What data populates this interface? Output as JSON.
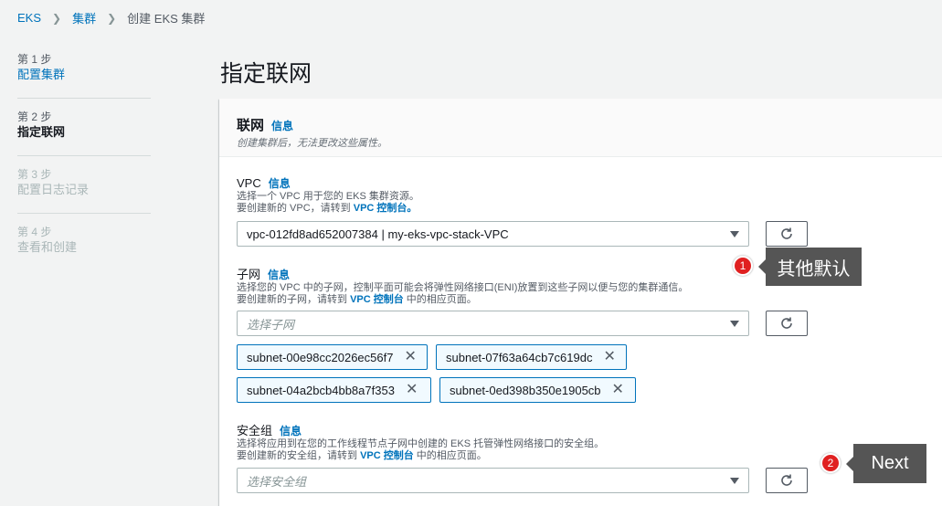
{
  "breadcrumb": {
    "root": "EKS",
    "clusters": "集群",
    "current": "创建 EKS 集群"
  },
  "steps": [
    {
      "num": "第 1 步",
      "name": "配置集群"
    },
    {
      "num": "第 2 步",
      "name": "指定联网"
    },
    {
      "num": "第 3 步",
      "name": "配置日志记录"
    },
    {
      "num": "第 4 步",
      "name": "查看和创建"
    }
  ],
  "page_title": "指定联网",
  "panel": {
    "title": "联网",
    "info": "信息",
    "desc": "创建集群后，无法更改这些属性。"
  },
  "vpc": {
    "label": "VPC",
    "info": "信息",
    "desc1": "选择一个 VPC 用于您的 EKS 集群资源。",
    "desc2_prefix": "要创建新的 VPC，请转到 ",
    "desc2_link": "VPC 控制台。",
    "value": "vpc-012fd8ad652007384 | my-eks-vpc-stack-VPC"
  },
  "subnets": {
    "label": "子网",
    "info": "信息",
    "desc1": "选择您的 VPC 中的子网，控制平面可能会将弹性网络接口(ENI)放置到这些子网以便与您的集群通信。",
    "desc2_prefix": "要创建新的子网，请转到 ",
    "desc2_link": "VPC 控制台",
    "desc2_suffix": " 中的相应页面。",
    "placeholder": "选择子网",
    "tokens": [
      "subnet-00e98cc2026ec56f7",
      "subnet-07f63a64cb7c619dc",
      "subnet-04a2bcb4bb8a7f353",
      "subnet-0ed398b350e1905cb"
    ]
  },
  "security_group": {
    "label": "安全组",
    "info": "信息",
    "desc1": "选择将应用到在您的工作线程节点子网中创建的 EKS 托管弹性网络接口的安全组。",
    "desc2_prefix": "要创建新的安全组，请转到 ",
    "desc2_link": "VPC 控制台",
    "desc2_suffix": " 中的相应页面。",
    "placeholder": "选择安全组"
  },
  "callouts": [
    {
      "num": "1",
      "text": "其他默认"
    },
    {
      "num": "2",
      "text": "Next"
    }
  ],
  "colors": {
    "link": "#0073bb",
    "callout_badge": "#e02020",
    "callout_box": "#555555",
    "token_border": "#0073bb"
  }
}
